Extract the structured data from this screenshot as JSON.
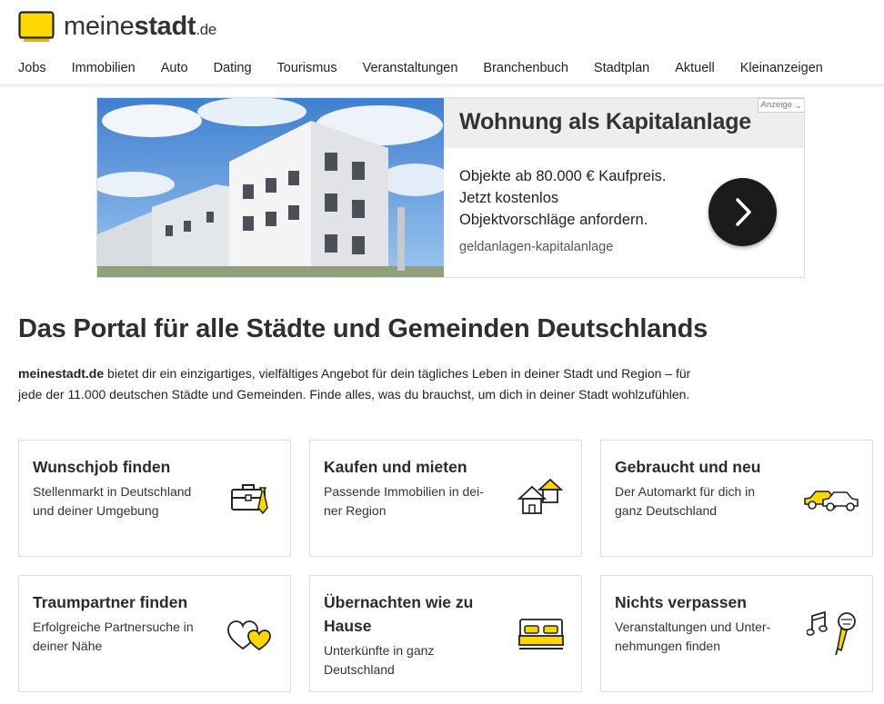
{
  "logo": {
    "name_regular": "meine",
    "name_bold": "stadt",
    "domain": ".de"
  },
  "nav": [
    "Jobs",
    "Immobilien",
    "Auto",
    "Dating",
    "Tourismus",
    "Veranstaltungen",
    "Branchenbuch",
    "Stadtplan",
    "Aktuell",
    "Kleinanzeigen"
  ],
  "ad": {
    "title": "Wohnung als Kapitalanlage",
    "tag": "Anzeige",
    "text_lines": [
      "Objekte ab 80.000 € Kaufpreis.",
      "Jetzt kostenlos",
      "Objektvorschläge anfordern."
    ],
    "source": "geldanlagen-kapitalanlage"
  },
  "headline": "Das Portal für alle Städte und Gemeinden Deutschlands",
  "intro": {
    "brand": "meinestadt.de",
    "line1": " bietet dir ein einzigartiges, vielfältiges Angebot für dein tägliches Leben in deiner Stadt und Region – für",
    "line2": "jede der 11.000 deutschen Städte und Gemeinden. Finde alles, was du brauchst, um dich in deiner Stadt wohlzufühlen."
  },
  "cards": [
    {
      "title": "Wunschjob finden",
      "desc_lines": [
        "Stellenmarkt in Deutschland",
        "und deiner Umgebung"
      ],
      "icon": "briefcase-icon"
    },
    {
      "title": "Kaufen und mieten",
      "desc_lines": [
        "Passende Immobilien in dei-",
        "ner Region"
      ],
      "icon": "houses-icon"
    },
    {
      "title": "Gebraucht und neu",
      "desc_lines": [
        "Der Automarkt für dich in",
        "ganz Deutschland"
      ],
      "icon": "cars-icon"
    },
    {
      "title": "Traumpartner finden",
      "desc_lines": [
        "Erfolgreiche Partnersuche in",
        "deiner Nähe"
      ],
      "icon": "hearts-icon"
    },
    {
      "title_lines": [
        "Übernachten wie zu",
        "Hause"
      ],
      "desc_lines": [
        "Unterkünfte in ganz",
        "Deutschland"
      ],
      "icon": "bed-icon"
    },
    {
      "title": "Nichts verpassen",
      "desc_lines": [
        "Veranstaltungen und Unter-",
        "nehmungen finden"
      ],
      "icon": "music-microphone-icon"
    }
  ],
  "colors": {
    "accent_yellow": "#ffd700",
    "dark": "#1b1b1b",
    "border": "#dddddd"
  }
}
